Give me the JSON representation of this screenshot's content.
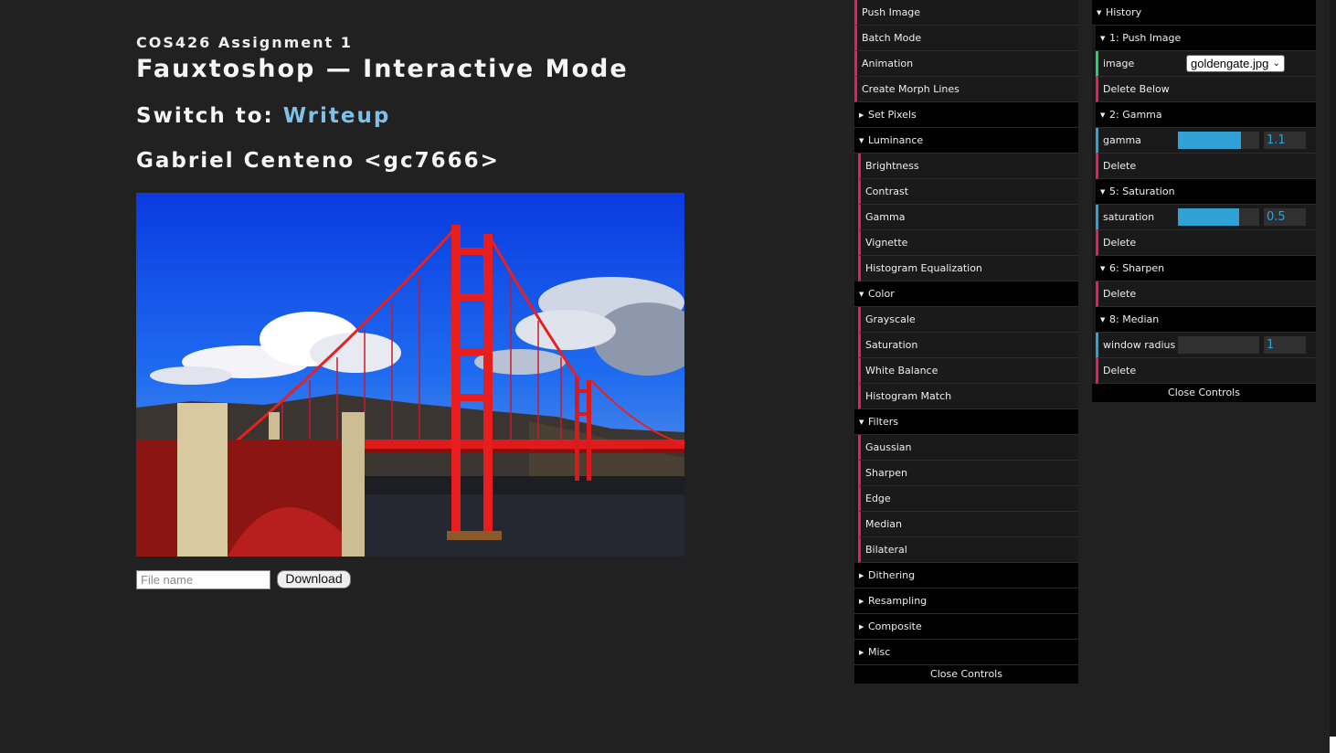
{
  "header": {
    "subtitle": "COS426 Assignment 1",
    "title": "Fauxtoshop — Interactive Mode",
    "switch_prefix": "Switch to: ",
    "switch_link": "Writeup",
    "author": "Gabriel Centeno <gc7666>"
  },
  "download": {
    "placeholder": "File name",
    "button": "Download"
  },
  "controls": {
    "items": {
      "push_image": "Push Image",
      "batch_mode": "Batch Mode",
      "animation": "Animation",
      "create_morph_lines": "Create Morph Lines",
      "set_pixels": "Set Pixels",
      "luminance": "Luminance",
      "brightness": "Brightness",
      "contrast": "Contrast",
      "gamma": "Gamma",
      "vignette": "Vignette",
      "histogram_equalization": "Histogram Equalization",
      "color": "Color",
      "grayscale": "Grayscale",
      "saturation": "Saturation",
      "white_balance": "White Balance",
      "histogram_match": "Histogram Match",
      "filters": "Filters",
      "gaussian": "Gaussian",
      "sharpen": "Sharpen",
      "edge": "Edge",
      "median": "Median",
      "bilateral": "Bilateral",
      "dithering": "Dithering",
      "resampling": "Resampling",
      "composite": "Composite",
      "misc": "Misc"
    },
    "close": "Close Controls"
  },
  "history": {
    "title": "History",
    "step1": "1: Push Image",
    "image_label": "image",
    "image_value": "goldengate.jpg",
    "delete_below": "Delete Below",
    "step2": "2: Gamma",
    "gamma_label": "gamma",
    "gamma_value": "1.1",
    "gamma_fill": 0.77,
    "delete": "Delete",
    "step5": "5: Saturation",
    "saturation_label": "saturation",
    "saturation_value": "0.5",
    "saturation_fill": 0.75,
    "step6": "6: Sharpen",
    "step8": "8: Median",
    "radius_label": "window radius",
    "radius_value": "1",
    "radius_fill": 0.0,
    "close": "Close Controls"
  },
  "colors": {
    "background": "#212121",
    "link": "#7fbfe9",
    "leaf_border": "#e61d5f",
    "number_border": "#2fa1d6",
    "string_border": "#1ed36f"
  }
}
